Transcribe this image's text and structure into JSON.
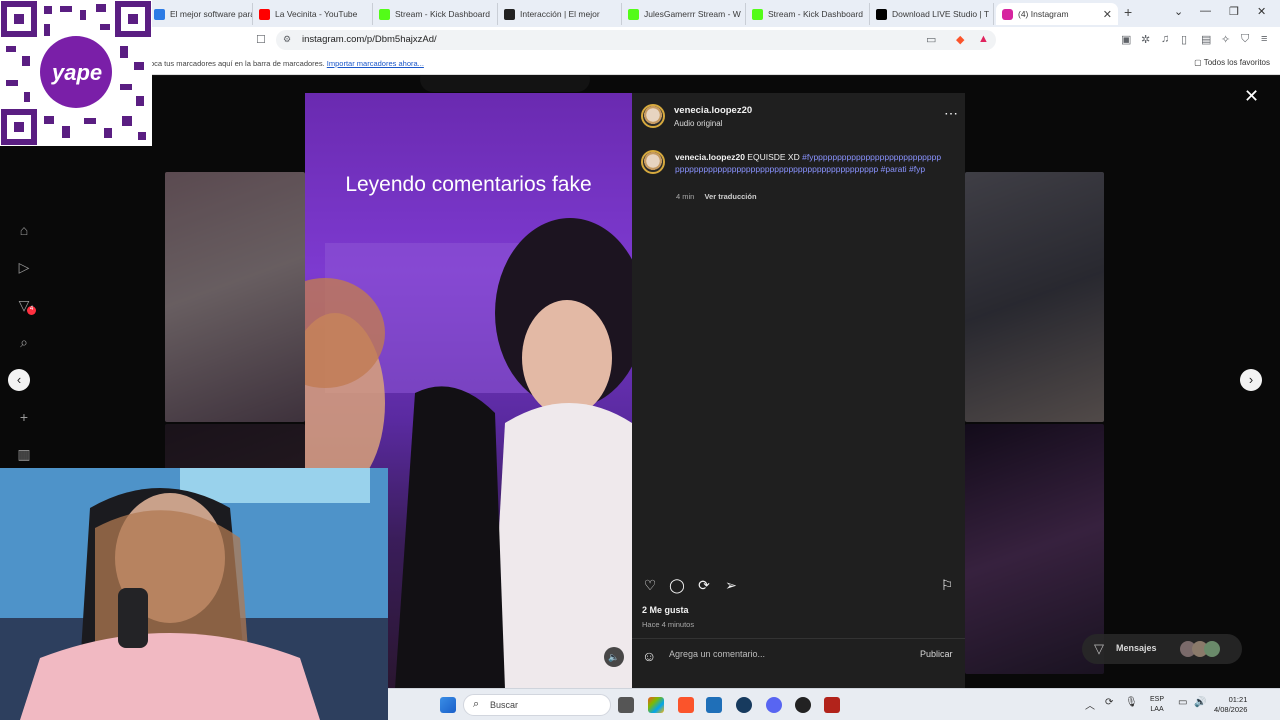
{
  "browser": {
    "tabs": [
      {
        "label": "El mejor software para po",
        "color": "#2c7be5"
      },
      {
        "label": "La Vecinita - YouTube",
        "color": "#ff0000"
      },
      {
        "label": "Stream - Kick Dashboard",
        "color": "#53fc18"
      },
      {
        "label": "Interacción | El mejor",
        "color": "#222222"
      },
      {
        "label": "JulesGamerrr Stream - W",
        "color": "#53fc18"
      },
      {
        "label": "Stream - Kick Dashboard",
        "color": "#53fc18"
      },
      {
        "label": "Download LIVE Studio | T",
        "color": "#000000"
      },
      {
        "label": "(4) Instagram",
        "color": "#d6249f"
      }
    ],
    "url": "instagram.com/p/Dbm5hajxzAd/",
    "bookmarks_message": "oca tus marcadores aquí en la barra de marcadores.",
    "bookmarks_import": "Importar marcadores ahora...",
    "bookmarks_all": "Todos los favoritos"
  },
  "overlay": {
    "qr_brand": "yape"
  },
  "post": {
    "video_caption": "Leyendo comentarios fake",
    "author": "venecia.loopez20",
    "audio": "Audio original",
    "caption_user": "venecia.loopez20",
    "caption_text": "EQUISDE XD",
    "hashtags": "#fypppppppppppppppppppppppppppppppppppppppppppppppppppppppppppppppppppppp #parati #fyp",
    "caption_age": "4 min",
    "translate": "Ver traducción",
    "likes": "2 Me gusta",
    "time": "Hace 4 minutos",
    "comment_placeholder": "Agrega un comentario...",
    "publish": "Publicar"
  },
  "page": {
    "messages": "Mensajes",
    "notification_count": "4"
  },
  "taskbar": {
    "search": "Buscar",
    "lang_1": "ESP",
    "lang_2": "LAA",
    "time": "01:21",
    "date": "4/08/2026"
  }
}
